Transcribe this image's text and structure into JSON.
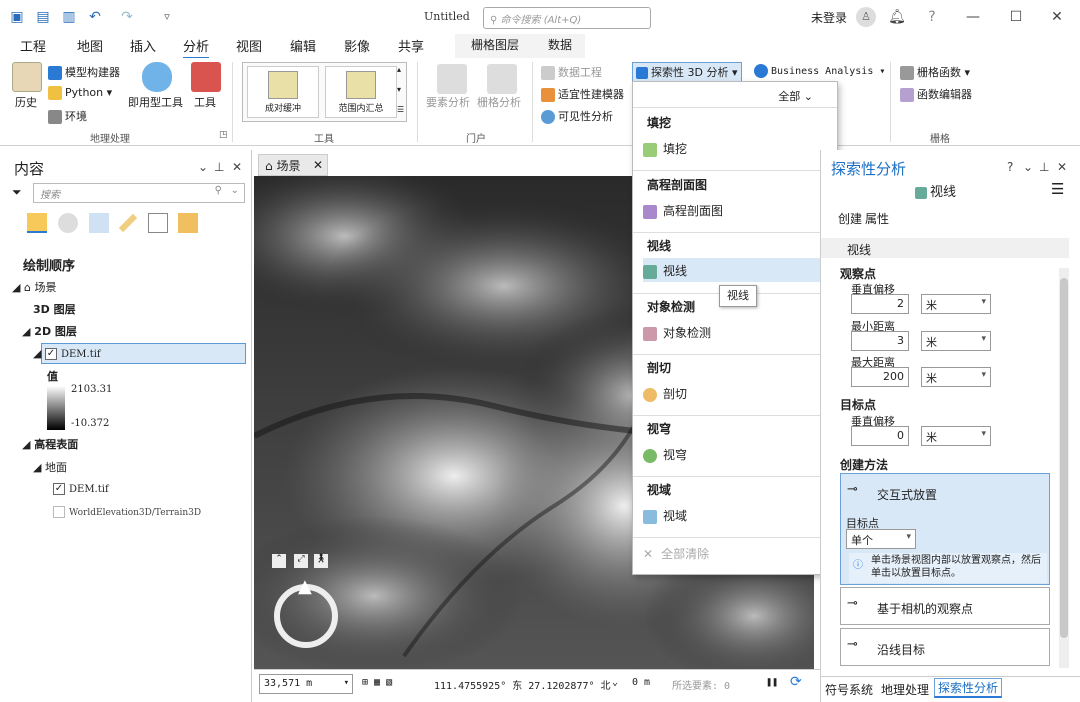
{
  "title_bar": {
    "doc_title": "Untitled",
    "search_placeholder": "命令搜索 (Alt+Q)",
    "login": "未登录",
    "icons": [
      "new-project-icon",
      "open-icon",
      "save-icon",
      "undo-icon",
      "redo-icon",
      "customize-icon"
    ]
  },
  "tabs": [
    "工程",
    "地图",
    "插入",
    "分析",
    "视图",
    "编辑",
    "影像",
    "共享",
    "栅格图层",
    "数据"
  ],
  "active_tab": "分析",
  "ribbon": {
    "geoprocessing": {
      "history": "历史",
      "model_builder": "模型构建器",
      "python": "Python",
      "environments": "环境",
      "ready_tools": "即用型工具",
      "tools": "工具",
      "group": "地理处理"
    },
    "gallery": {
      "items": [
        "成对缓冲",
        "范围内汇总"
      ],
      "group": "工具"
    },
    "portal": {
      "feature_analysis": "要素分析",
      "raster_analysis": "栅格分析",
      "group": "门户"
    },
    "workflows": {
      "data_engineering": "数据工程",
      "suitability": "适宜性建模器",
      "visibility": "可见性分析",
      "exploratory": "探索性 3D 分析",
      "business": "Business Analysis"
    },
    "raster": {
      "raster_functions": "栅格函数",
      "function_editor": "函数编辑器",
      "group": "栅格"
    }
  },
  "contents": {
    "title": "内容",
    "search_placeholder": "搜索",
    "drawing_order": "绘制顺序",
    "scene": "场景",
    "layers_3d": "3D 图层",
    "layers_2d": "2D 图层",
    "dem_layer": "DEM.tif",
    "legend_title": "值",
    "legend_max": "2103.31",
    "legend_min": "-10.372",
    "elevation_surfaces": "高程表面",
    "ground": "地面",
    "ground_dem": "DEM.tif",
    "world_elev": "WorldElevation3D/Terrain3D"
  },
  "map": {
    "tab": "场景",
    "scale": "33,571 m",
    "coords": "111.4755925° 东 27.1202877° 北",
    "elev": "0 m",
    "selected": "所选要素: 0"
  },
  "dropdown": {
    "filter": "全部",
    "sections": [
      {
        "head": "填挖",
        "item": "填挖",
        "icon": "cut-fill-icon"
      },
      {
        "head": "高程剖面图",
        "item": "高程剖面图",
        "icon": "elevation-profile-icon"
      },
      {
        "head": "视线",
        "item": "视线",
        "icon": "line-of-sight-icon"
      },
      {
        "head": "对象检测",
        "item": "对象检测",
        "icon": "object-detection-icon"
      },
      {
        "head": "剖切",
        "item": "剖切",
        "icon": "slice-icon"
      },
      {
        "head": "视穹",
        "item": "视穹",
        "icon": "view-dome-icon"
      },
      {
        "head": "视域",
        "item": "视域",
        "icon": "viewshed-icon"
      }
    ],
    "clear_all": "全部清除",
    "tooltip": "视线"
  },
  "right_panel": {
    "title": "探索性分析",
    "subtitle": "视线",
    "tab_create": "创建",
    "tab_props": "属性",
    "section": "视线",
    "observer": "观察点",
    "vertical_offset": "垂直偏移",
    "vertical_offset_val": "2",
    "min_distance": "最小距离",
    "min_distance_val": "3",
    "max_distance": "最大距离",
    "max_distance_val": "200",
    "unit": "米",
    "target": "目标点",
    "target_offset": "垂直偏移",
    "target_offset_val": "0",
    "creation_method": "创建方法",
    "interactive": "交互式放置",
    "target_points": "目标点",
    "target_mode": "单个",
    "hint": "单击场景视图内部以放置观察点，然后单击以放置目标点。",
    "camera": "基于相机的观察点",
    "along_line": "沿线目标",
    "bottom_tabs": [
      "符号系统",
      "地理处理",
      "探索性分析"
    ]
  },
  "colors": {
    "accent": "#2a7ad5",
    "highlight": "#d9e8f7",
    "brand_blue": "#1a6fc4"
  }
}
